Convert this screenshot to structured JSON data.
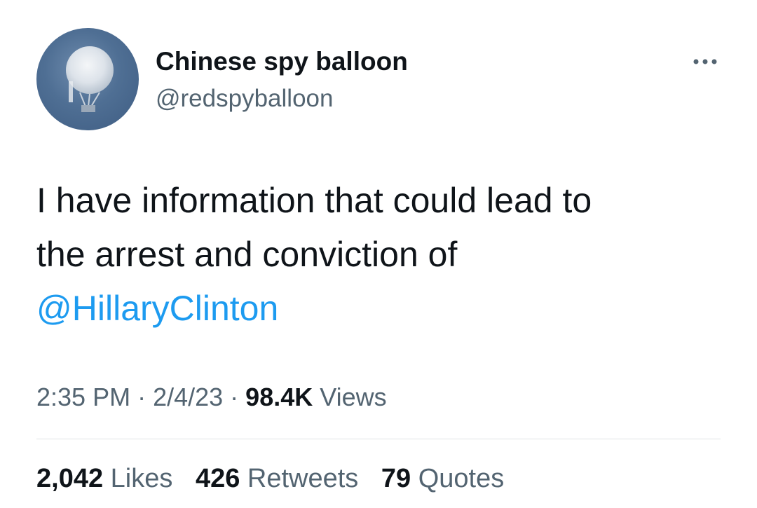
{
  "author": {
    "display_name": "Chinese spy balloon",
    "handle": "@redspyballoon",
    "avatar_icon": "balloon-avatar-icon"
  },
  "more_icon": "more-options-icon",
  "tweet": {
    "line1": "I have information that could lead to",
    "line2": "the arrest and conviction of",
    "mention": "@HillaryClinton"
  },
  "meta": {
    "time": "2:35 PM",
    "sep1": " · ",
    "date": "2/4/23",
    "sep2": " · ",
    "views_count": "98.4K",
    "views_label": "Views"
  },
  "stats": {
    "likes_count": "2,042",
    "likes_label": "Likes",
    "retweets_count": "426",
    "retweets_label": "Retweets",
    "quotes_count": "79",
    "quotes_label": "Quotes"
  },
  "colors": {
    "link": "#1d9bf0",
    "secondary_text": "#536471",
    "primary_text": "#0f1419",
    "divider": "#dfe3e6"
  }
}
